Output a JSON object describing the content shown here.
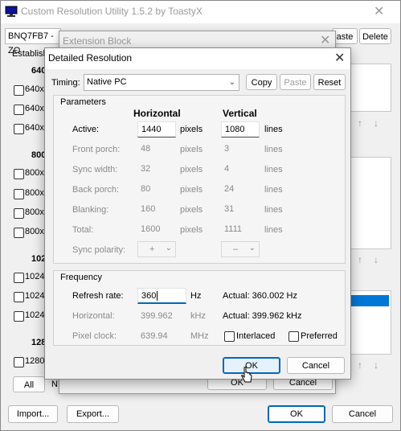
{
  "main": {
    "title": "Custom Resolution Utility 1.5.2 by ToastyX",
    "monitor_select": "BNQ7FB7 - ZO",
    "paste_label": "aste",
    "delete_label": "Delete",
    "established_label": "Establish",
    "groups": [
      {
        "label": "640",
        "items": [
          "640x",
          "640x",
          "640x"
        ]
      },
      {
        "label": "800",
        "items": [
          "800x",
          "800x",
          "800x",
          "800x"
        ]
      },
      {
        "label": "102",
        "items": [
          "1024",
          "1024",
          "1024"
        ]
      },
      {
        "label": "128",
        "items": [
          "1280"
        ]
      }
    ],
    "all_label": "All",
    "n_label": "N",
    "import_label": "Import...",
    "export_label": "Export...",
    "ok_label": "OK",
    "cancel_label": "Cancel",
    "up_arrow": "↑",
    "down_arrow": "↓"
  },
  "ext_block": {
    "title": "Extension Block",
    "ok_label": "OK",
    "cancel_label": "Cancel"
  },
  "dialog": {
    "title": "Detailed Resolution",
    "timing_label": "Timing:",
    "timing_value": "Native PC",
    "copy_label": "Copy",
    "paste_label": "Paste",
    "reset_label": "Reset",
    "parameters_label": "Parameters",
    "horizontal_header": "Horizontal",
    "vertical_header": "Vertical",
    "rows": [
      {
        "label": "Active:",
        "h": "1440",
        "h_unit": "pixels",
        "v": "1080",
        "v_unit": "lines"
      },
      {
        "label": "Front porch:",
        "h": "48",
        "h_unit": "pixels",
        "v": "3",
        "v_unit": "lines"
      },
      {
        "label": "Sync width:",
        "h": "32",
        "h_unit": "pixels",
        "v": "4",
        "v_unit": "lines"
      },
      {
        "label": "Back porch:",
        "h": "80",
        "h_unit": "pixels",
        "v": "24",
        "v_unit": "lines"
      },
      {
        "label": "Blanking:",
        "h": "160",
        "h_unit": "pixels",
        "v": "31",
        "v_unit": "lines"
      },
      {
        "label": "Total:",
        "h": "1600",
        "h_unit": "pixels",
        "v": "1111",
        "v_unit": "lines"
      }
    ],
    "sync_polarity_label": "Sync polarity:",
    "h_polarity": "+",
    "v_polarity": "–",
    "frequency_label": "Frequency",
    "refresh_label": "Refresh rate:",
    "refresh_value": "360",
    "refresh_unit": "Hz",
    "refresh_actual": "Actual: 360.002 Hz",
    "horizontal_label": "Horizontal:",
    "horizontal_value": "399.962",
    "horizontal_unit": "kHz",
    "horizontal_actual": "Actual: 399.962 kHz",
    "pixel_clock_label": "Pixel clock:",
    "pixel_clock_value": "639.94",
    "pixel_clock_unit": "MHz",
    "interlaced_label": "Interlaced",
    "preferred_label": "Preferred",
    "ok_label": "OK",
    "cancel_label": "Cancel"
  }
}
